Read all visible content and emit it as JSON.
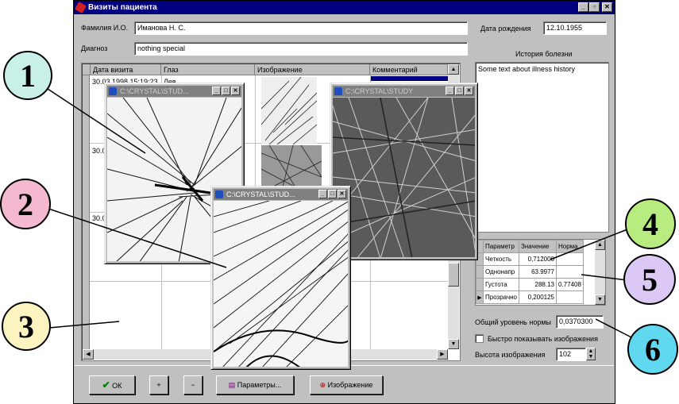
{
  "window": {
    "title": "Визиты пациента",
    "controls": [
      "_",
      "▫",
      "✕"
    ]
  },
  "patient": {
    "name_label": "Фамилия И.О.",
    "name_value": "Иманова Н. С.",
    "diagnosis_label": "Диагноз",
    "diagnosis_value": "nothing special",
    "birth_label": "Дата рождения",
    "birth_value": "12.10.1955"
  },
  "visits_grid": {
    "columns": [
      "Дата визита",
      "Глаз",
      "Изображение",
      "Комментарий"
    ],
    "rows": [
      {
        "date": "30.03.1998 15:19:23",
        "eye": "Лев"
      },
      {
        "date": "30.0",
        "eye": ""
      },
      {
        "date": "30.0",
        "eye": ""
      }
    ]
  },
  "history": {
    "label": "История болезни",
    "text": "Some text about illness history"
  },
  "params": {
    "columns": [
      "Параметр",
      "Значение",
      "Норма"
    ],
    "rows": [
      {
        "name": "Четкость",
        "value": "0,712000",
        "norm": ""
      },
      {
        "name": "Однонапр",
        "value": "63.9977",
        "norm": ""
      },
      {
        "name": "Густота",
        "value": "288.13",
        "norm": "0.77408"
      },
      {
        "name": "Прозрачно",
        "value": "0,200125",
        "norm": ""
      }
    ]
  },
  "overall": {
    "label": "Общий уровень нормы",
    "value": "0,0370300"
  },
  "fast_images": {
    "label": "Быстро показывать изображения",
    "checked": false
  },
  "image_height": {
    "label": "Высота изображения",
    "value": "102"
  },
  "buttons": {
    "ok": "ОК",
    "plus": "+",
    "minus": "−",
    "parameters": "Параметры...",
    "image": "Изображение"
  },
  "image_windows": [
    {
      "title": "C:\\CRYSTAL\\STUD..."
    },
    {
      "title": "C:\\CRYSTAL\\STUDY"
    },
    {
      "title": "C:\\CRYSTAL\\STUD..."
    }
  ],
  "callouts": [
    {
      "number": "1",
      "color": "#c8f0e8"
    },
    {
      "number": "2",
      "color": "#f4b8d0"
    },
    {
      "number": "3",
      "color": "#fbf3c0"
    },
    {
      "number": "4",
      "color": "#b8ec80"
    },
    {
      "number": "5",
      "color": "#dcc8f4"
    },
    {
      "number": "6",
      "color": "#60d8f0"
    }
  ]
}
